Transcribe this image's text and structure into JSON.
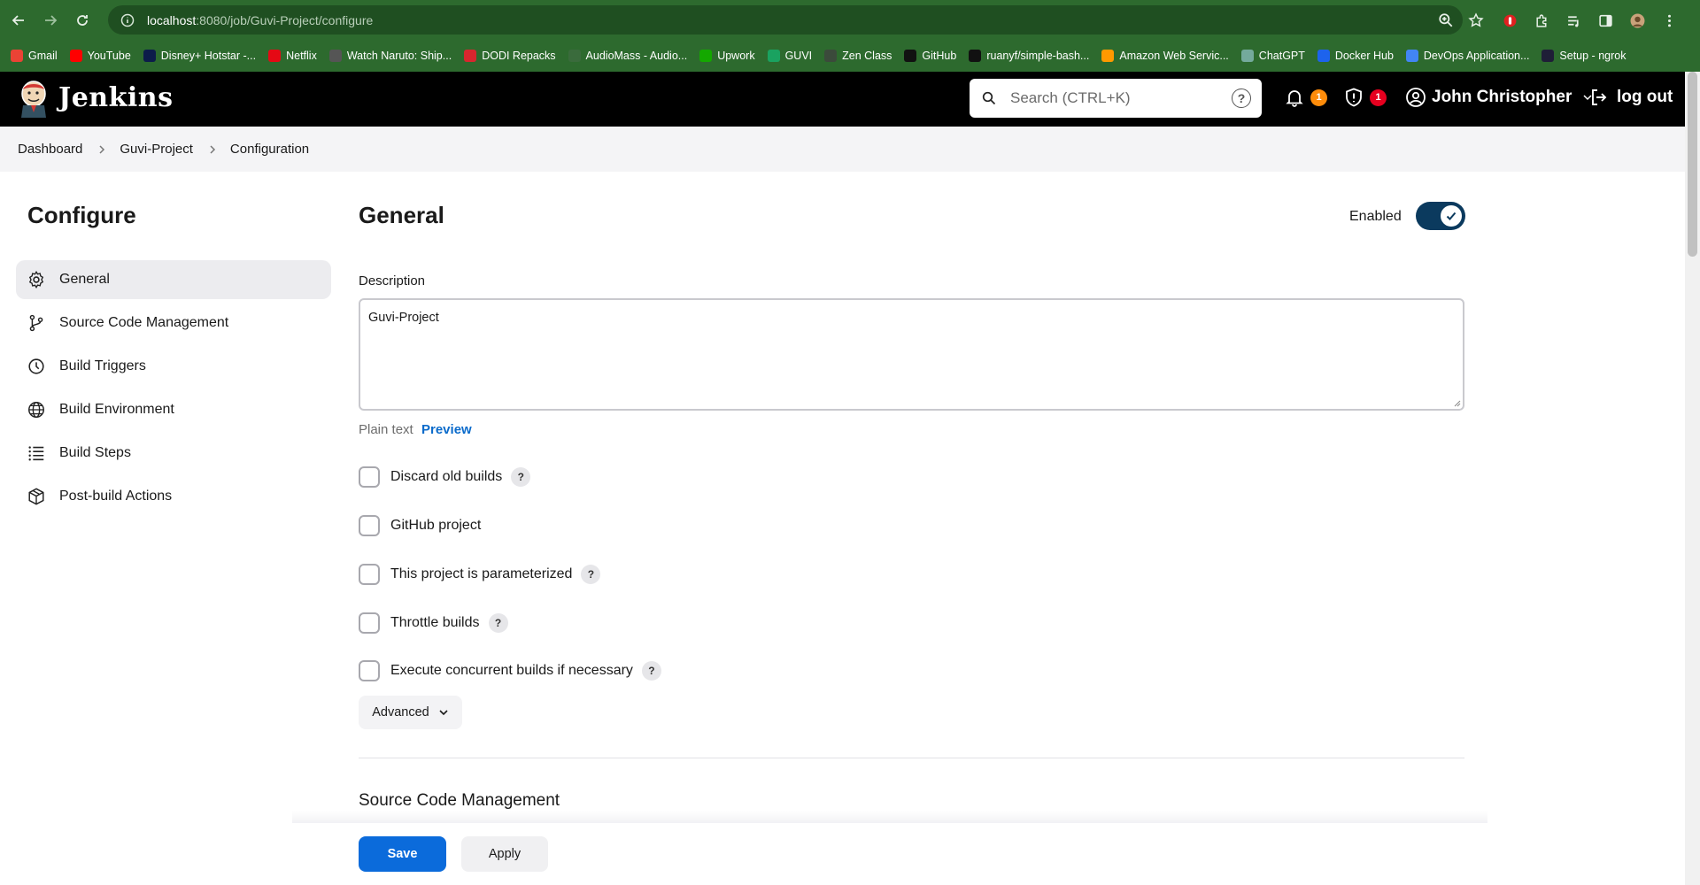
{
  "browser": {
    "url_host": "localhost",
    "url_path": ":8080/job/Guvi-Project/configure",
    "bookmarks": [
      {
        "label": "Gmail",
        "icon": "gmail-icon",
        "color": "#ea4335"
      },
      {
        "label": "YouTube",
        "icon": "youtube-icon",
        "color": "#ff0000"
      },
      {
        "label": "Disney+ Hotstar -...",
        "icon": "hotstar-icon",
        "color": "#0c1c4a"
      },
      {
        "label": "Netflix",
        "icon": "netflix-icon",
        "color": "#e50914"
      },
      {
        "label": "Watch Naruto: Ship...",
        "icon": "naruto-icon",
        "color": "#555555"
      },
      {
        "label": "DODI Repacks",
        "icon": "dodi-icon",
        "color": "#d7262e"
      },
      {
        "label": "AudioMass - Audio...",
        "icon": "audiomass-icon",
        "color": "#3a6b3c"
      },
      {
        "label": "Upwork",
        "icon": "upwork-icon",
        "color": "#14a800"
      },
      {
        "label": "GUVI",
        "icon": "guvi-icon",
        "color": "#1aa260"
      },
      {
        "label": "Zen Class",
        "icon": "zenclass-icon",
        "color": "#3b4a3b"
      },
      {
        "label": "GitHub",
        "icon": "github-icon",
        "color": "#111111"
      },
      {
        "label": "ruanyf/simple-bash...",
        "icon": "github-icon",
        "color": "#111111"
      },
      {
        "label": "Amazon Web Servic...",
        "icon": "aws-icon",
        "color": "#ff9900"
      },
      {
        "label": "ChatGPT",
        "icon": "chatgpt-icon",
        "color": "#74aa9c"
      },
      {
        "label": "Docker Hub",
        "icon": "docker-icon",
        "color": "#1d63ed"
      },
      {
        "label": "DevOps Application...",
        "icon": "docs-icon",
        "color": "#4285f4"
      },
      {
        "label": "Setup - ngrok",
        "icon": "ngrok-icon",
        "color": "#1f1e37"
      }
    ]
  },
  "header": {
    "title": "Jenkins",
    "search_placeholder": "Search (CTRL+K)",
    "help": "?",
    "notifications_count": "1",
    "security_count": "1",
    "user_name": "John Christopher",
    "logout_label": "log out"
  },
  "breadcrumb": [
    "Dashboard",
    "Guvi-Project",
    "Configuration"
  ],
  "sidebar": {
    "title": "Configure",
    "items": [
      {
        "label": "General",
        "icon": "gear-icon"
      },
      {
        "label": "Source Code Management",
        "icon": "branch-icon"
      },
      {
        "label": "Build Triggers",
        "icon": "clock-icon"
      },
      {
        "label": "Build Environment",
        "icon": "globe-icon"
      },
      {
        "label": "Build Steps",
        "icon": "list-icon"
      },
      {
        "label": "Post-build Actions",
        "icon": "package-icon"
      }
    ]
  },
  "general": {
    "title": "General",
    "enabled_label": "Enabled",
    "enabled": true,
    "description_label": "Description",
    "description_value": "Guvi-Project",
    "plain_text_label": "Plain text",
    "preview_label": "Preview",
    "options": [
      {
        "label": "Discard old builds",
        "checked": false,
        "help": "?"
      },
      {
        "label": "GitHub project",
        "checked": false,
        "help": ""
      },
      {
        "label": "This project is parameterized",
        "checked": false,
        "help": "?"
      },
      {
        "label": "Throttle builds",
        "checked": false,
        "help": "?"
      },
      {
        "label": "Execute concurrent builds if necessary",
        "checked": false,
        "help": "?"
      }
    ],
    "advanced_label": "Advanced"
  },
  "next_section_title": "Source Code Management",
  "actions": {
    "save_label": "Save",
    "apply_label": "Apply"
  },
  "colors": {
    "header_bg": "#000000",
    "primary": "#0b6bdb",
    "toggle": "#0b3a5e",
    "badge_orange": "#fe8c0a",
    "badge_red": "#e6001f",
    "browser_chrome": "#2d6a2e"
  }
}
